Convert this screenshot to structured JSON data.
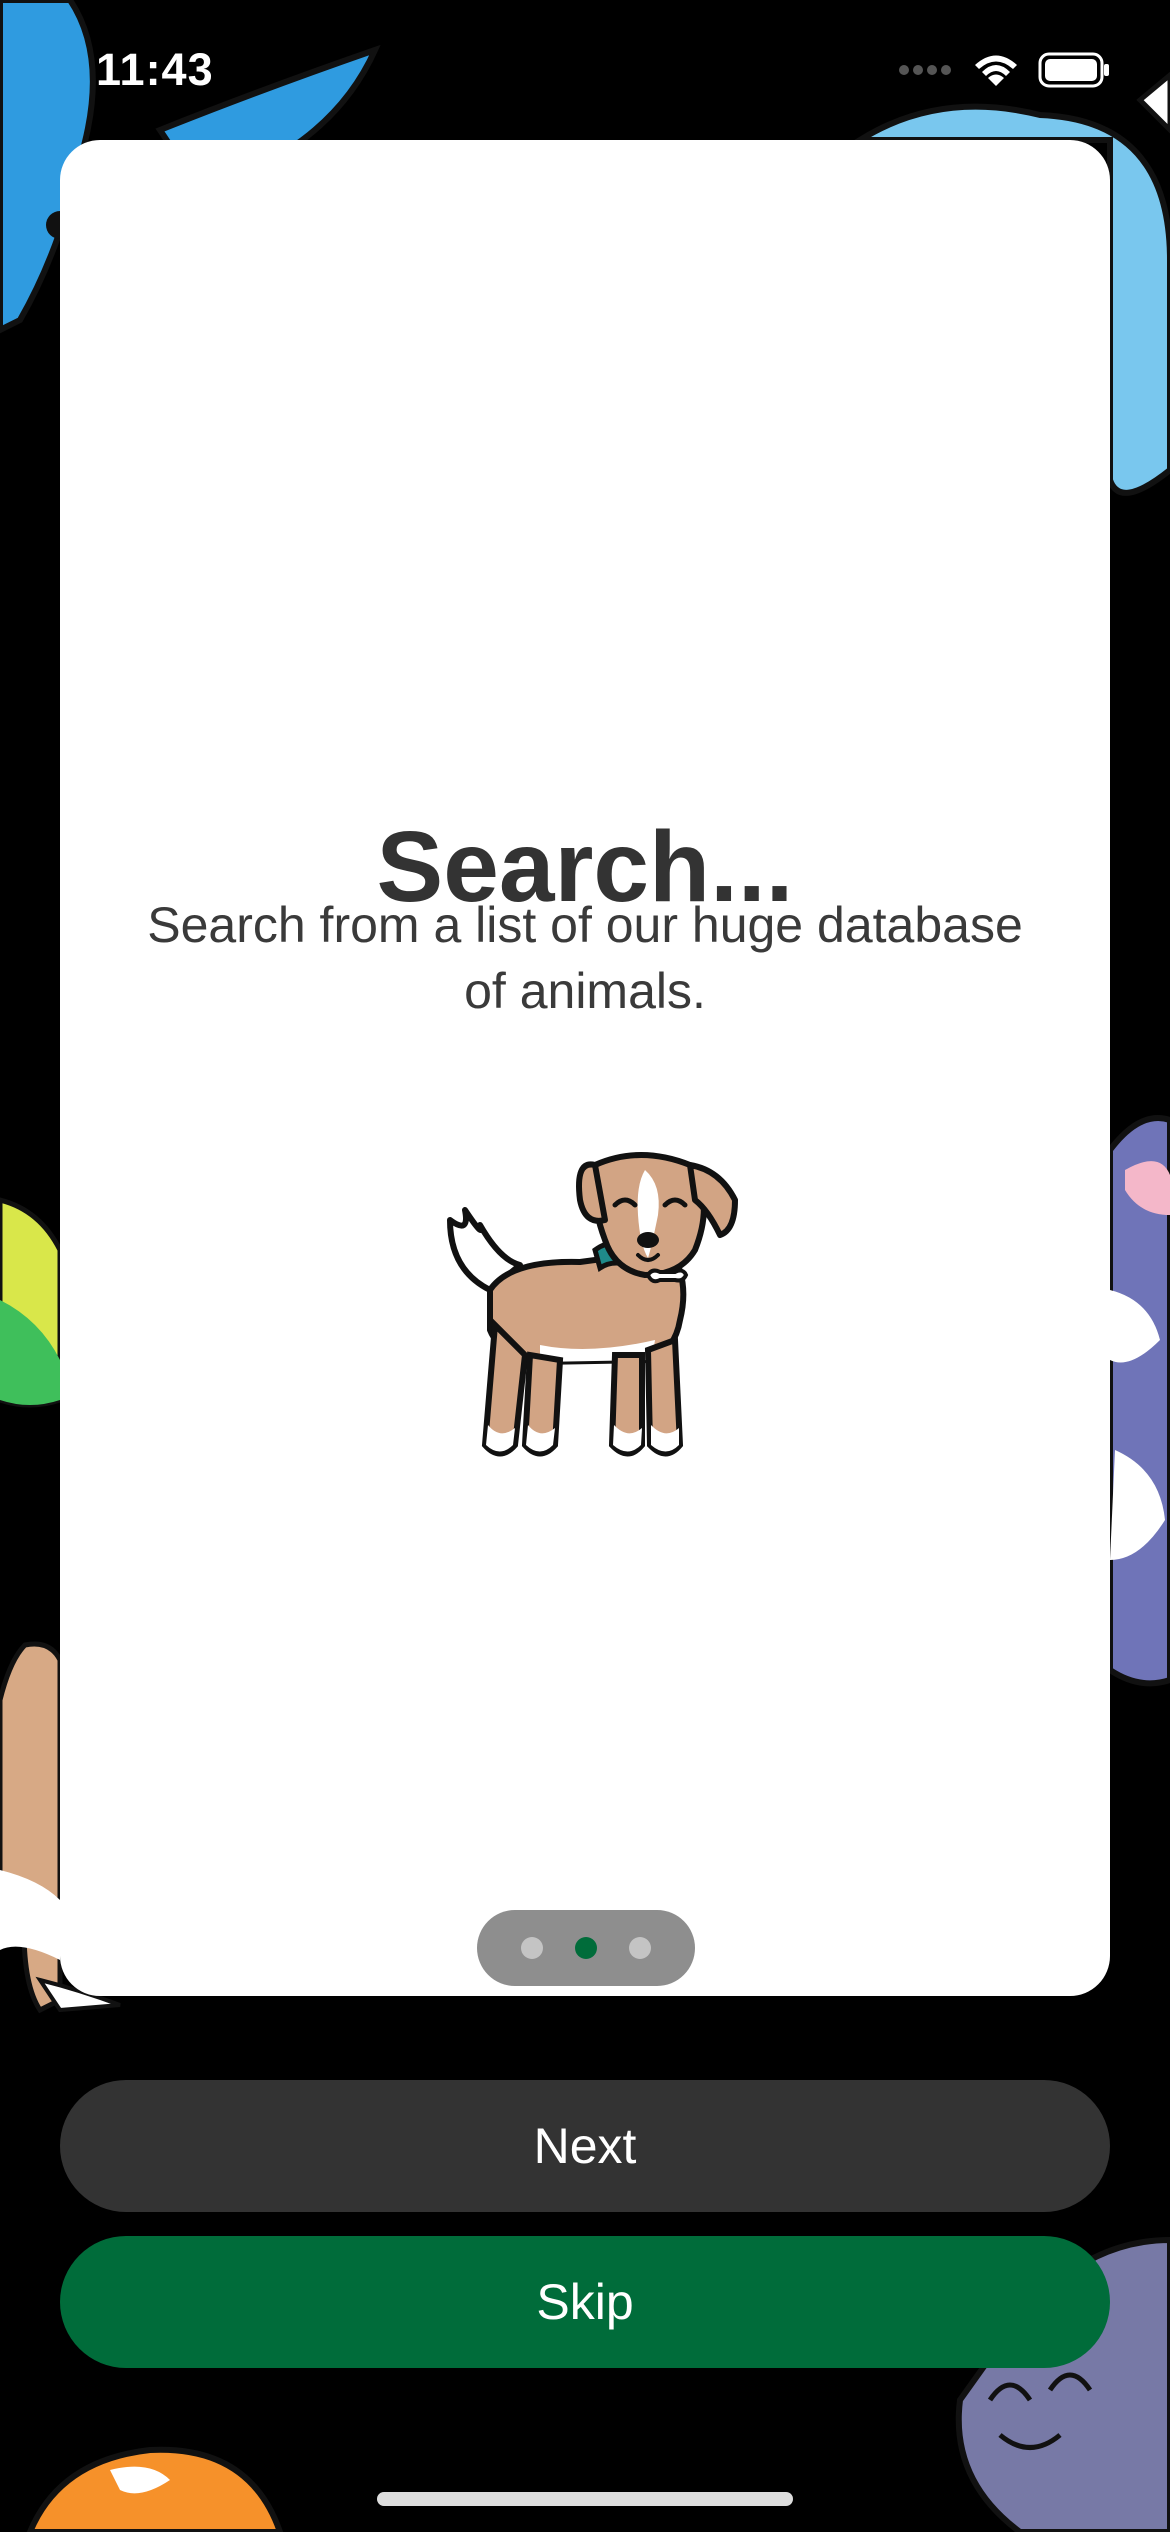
{
  "status_bar": {
    "time": "11:43",
    "icons": [
      "signal-icon",
      "wifi-icon",
      "battery-icon"
    ]
  },
  "card": {
    "title": "Search...",
    "body": "Search from a list of our huge database of animals.",
    "illustration": "dog-illustration",
    "page_indicator": {
      "total": 3,
      "current": 2
    }
  },
  "buttons": {
    "next_label": "Next",
    "skip_label": "Skip"
  },
  "colors": {
    "background": "#000000",
    "card": "#ffffff",
    "next_button": "#333333",
    "skip_button": "#006c3a",
    "active_dot": "#006c3a"
  }
}
